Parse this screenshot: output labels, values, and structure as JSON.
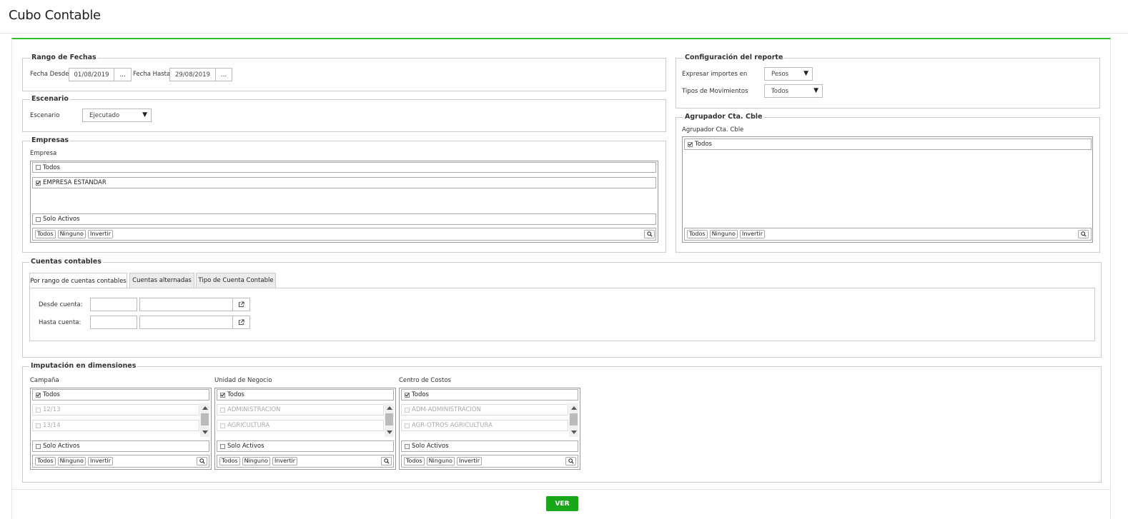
{
  "page": {
    "title": "Cubo Contable"
  },
  "fechas": {
    "legend": "Rango de Fechas",
    "desde_label": "Fecha Desde",
    "desde_value": "01/08/2019",
    "hasta_label": "Fecha Hasta",
    "hasta_value": "29/08/2019",
    "picker_label": "..."
  },
  "escenario": {
    "legend": "Escenario",
    "label": "Escenario",
    "value": "Ejecutado"
  },
  "empresas": {
    "legend": "Empresas",
    "label": "Empresa",
    "todos": "Todos",
    "item": "EMPRESA ESTANDAR",
    "solo_activos": "Solo Activos"
  },
  "config": {
    "legend": "Configuración del reporte",
    "importes_label": "Expresar importes en",
    "importes_value": "Pesos",
    "movimientos_label": "Tipos de Movimientos",
    "movimientos_value": "Todos"
  },
  "agrupador": {
    "legend": "Agrupador Cta. Cble",
    "label": "Agrupador Cta. Cble",
    "todos": "Todos"
  },
  "actions": {
    "todos": "Todos",
    "ninguno": "Ninguno",
    "invertir": "Invertir"
  },
  "cuentas": {
    "legend": "Cuentas contables",
    "tabs": [
      "Por rango de cuentas contables",
      "Cuentas alternadas",
      "Tipo de Cuenta Contable"
    ],
    "desde_label": "Desde cuenta:",
    "hasta_label": "Hasta cuenta:"
  },
  "dimensiones": {
    "legend": "Imputación en dimensiones",
    "campana": {
      "label": "Campaña",
      "todos": "Todos",
      "items": [
        "12/13",
        "13/14"
      ],
      "solo_activos": "Solo Activos"
    },
    "unidad": {
      "label": "Unidad de Negocio",
      "todos": "Todos",
      "items": [
        "ADMINISTRACION",
        "AGRICULTURA"
      ],
      "solo_activos": "Solo Activos"
    },
    "centro": {
      "label": "Centro de Costos",
      "todos": "Todos",
      "items": [
        "ADM-ADMINISTRACION",
        "AGR-OTROS AGRICULTURA"
      ],
      "solo_activos": "Solo Activos"
    }
  },
  "ver_label": "VER",
  "colors": {
    "accent": "#2ec22e",
    "button": "#19a719"
  }
}
